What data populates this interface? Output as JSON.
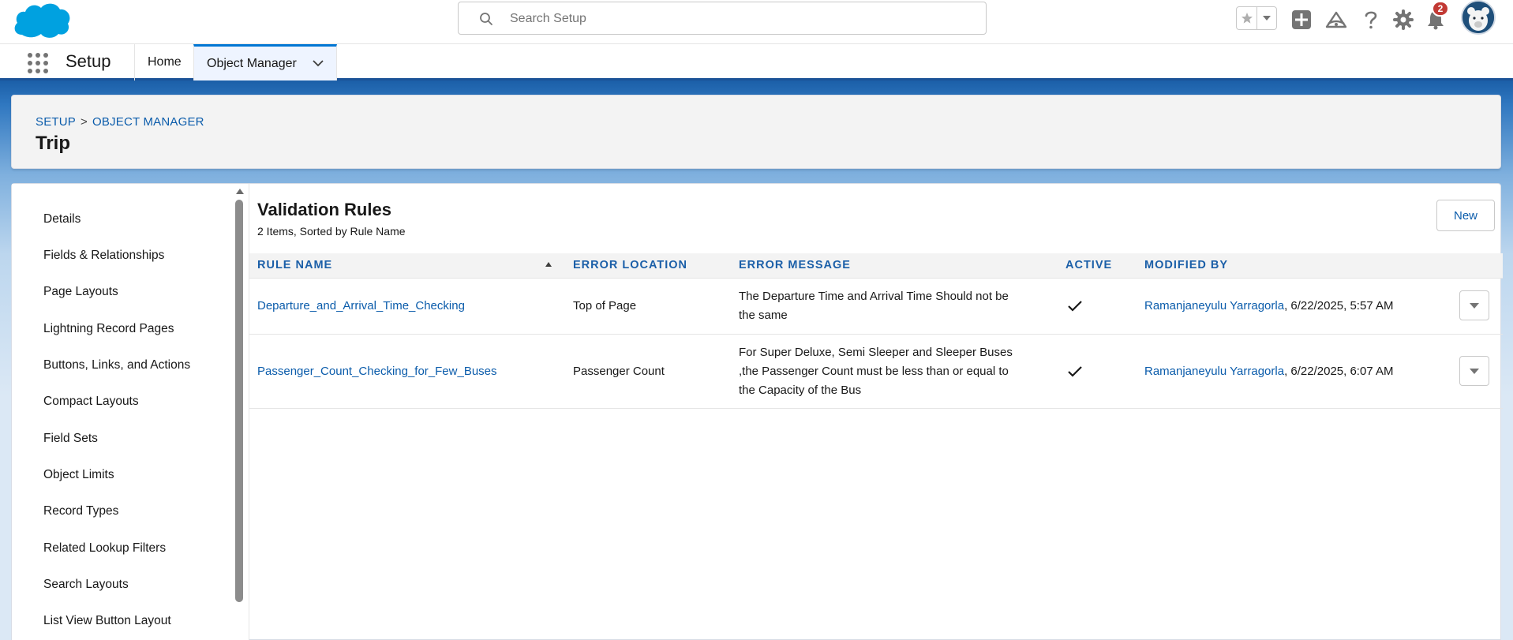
{
  "header": {
    "search_placeholder": "Search Setup",
    "notification_count": "2"
  },
  "context_bar": {
    "app_name": "Setup",
    "tabs": [
      {
        "label": "Home"
      },
      {
        "label": "Object Manager"
      }
    ]
  },
  "page_header": {
    "breadcrumb": [
      "SETUP",
      "OBJECT MANAGER"
    ],
    "breadcrumb_separator": ">",
    "title": "Trip"
  },
  "sidebar": {
    "items": [
      {
        "label": "Details"
      },
      {
        "label": "Fields & Relationships"
      },
      {
        "label": "Page Layouts"
      },
      {
        "label": "Lightning Record Pages"
      },
      {
        "label": "Buttons, Links, and Actions"
      },
      {
        "label": "Compact Layouts"
      },
      {
        "label": "Field Sets"
      },
      {
        "label": "Object Limits"
      },
      {
        "label": "Record Types"
      },
      {
        "label": "Related Lookup Filters"
      },
      {
        "label": "Search Layouts"
      },
      {
        "label": "List View Button Layout"
      }
    ]
  },
  "main": {
    "title": "Validation Rules",
    "subtitle": "2 Items, Sorted by Rule Name",
    "new_button": "New",
    "columns": [
      "RULE NAME",
      "ERROR LOCATION",
      "ERROR MESSAGE",
      "ACTIVE",
      "MODIFIED BY"
    ],
    "rows": [
      {
        "rule_name": "Departure_and_Arrival_Time_Checking",
        "error_location": "Top of Page",
        "error_message_lines": [
          "The Departure Time and Arrival Time Should not be",
          "the same"
        ],
        "active": true,
        "modified_by_name": "Ramanjaneyulu Yarragorla",
        "modified_date": ", 6/22/2025, 5:57 AM"
      },
      {
        "rule_name": "Passenger_Count_Checking_for_Few_Buses",
        "error_location": "Passenger Count",
        "error_message_lines": [
          "For Super Deluxe, Semi Sleeper and Sleeper Buses",
          ",the Passenger Count must be less than or equal to",
          "the Capacity of the Bus"
        ],
        "active": true,
        "modified_by_name": "Ramanjaneyulu Yarragorla",
        "modified_date": ", 6/22/2025, 6:07 AM"
      }
    ]
  },
  "colors": {
    "brand_blue": "#0176d3",
    "link_blue": "#0b5cab",
    "header_label_blue": "#1b5fa8",
    "badge_red": "#c23934"
  },
  "icons": [
    "salesforce-cloud-logo",
    "search-icon",
    "favorites-star-icon",
    "favorites-menu-icon",
    "global-add-icon",
    "trailhead-icon",
    "help-icon",
    "gear-icon",
    "bell-icon",
    "avatar",
    "app-launcher-icon",
    "chevron-down-icon",
    "check-icon"
  ]
}
